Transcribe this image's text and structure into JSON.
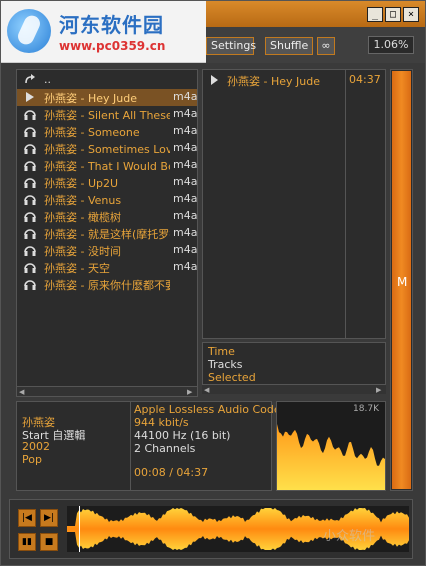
{
  "watermark": {
    "site_name": "河东软件园",
    "site_url": "www.pc0359.cn",
    "corner_text": "小众软件"
  },
  "toolbar": {
    "settings_label": "Settings",
    "shuffle_label": "Shuffle",
    "repeat_symbol": "∞",
    "progress_percent": "1.06%"
  },
  "window_buttons": {
    "minimize": "_",
    "maximize": "□",
    "close": "×"
  },
  "playlist": {
    "parent_label": "..",
    "items": [
      {
        "name": "孙燕姿 - Hey Jude",
        "format": "m4a",
        "selected": true
      },
      {
        "name": "孙燕姿 - Silent All These Years",
        "format": "m4a"
      },
      {
        "name": "孙燕姿 - Someone",
        "format": "m4a"
      },
      {
        "name": "孙燕姿 - Sometimes Love Just",
        "format": "m4a"
      },
      {
        "name": "孙燕姿 - That I Would Be Gooc",
        "format": "m4a"
      },
      {
        "name": "孙燕姿 - Up2U",
        "format": "m4a"
      },
      {
        "name": "孙燕姿 - Venus",
        "format": "m4a"
      },
      {
        "name": "孙燕姿 - 橄榄树",
        "format": "m4a"
      },
      {
        "name": "孙燕姿 - 就是这样(摩托罗拉",
        "format": "m4a"
      },
      {
        "name": "孙燕姿 - 没时间",
        "format": "m4a"
      },
      {
        "name": "孙燕姿 - 天空",
        "format": "m4a"
      },
      {
        "name": "孙燕姿 - 原来你什麽都不要.r",
        "format": ""
      }
    ]
  },
  "now_playing": {
    "title": "孙燕姿 - Hey Jude",
    "duration": "04:37"
  },
  "stats": {
    "time_label": "Time",
    "tracks_label": "Tracks",
    "selected_label": "Selected"
  },
  "volume": {
    "label": "M",
    "level": 1.0
  },
  "track_info": {
    "artist": "孙燕姿",
    "album": "Start 自選輯",
    "year": "2002",
    "genre": "Pop",
    "codec": "Apple Lossless Audio Codec",
    "bitrate": "944 kbit/s",
    "sample_rate": "44100 Hz (16 bit)",
    "channels": "2 Channels",
    "position": "00:08 / 04:37"
  },
  "spectrum": {
    "freq_label": "18.7K"
  },
  "transport": {
    "prev_symbol": "|◀",
    "next_symbol": "▶|",
    "pause_symbol": "▮▮",
    "stop_symbol": "■"
  },
  "colors": {
    "accent": "#e8a43a",
    "selected_row": "#7a5224",
    "volume_fill": "#f08a22"
  }
}
